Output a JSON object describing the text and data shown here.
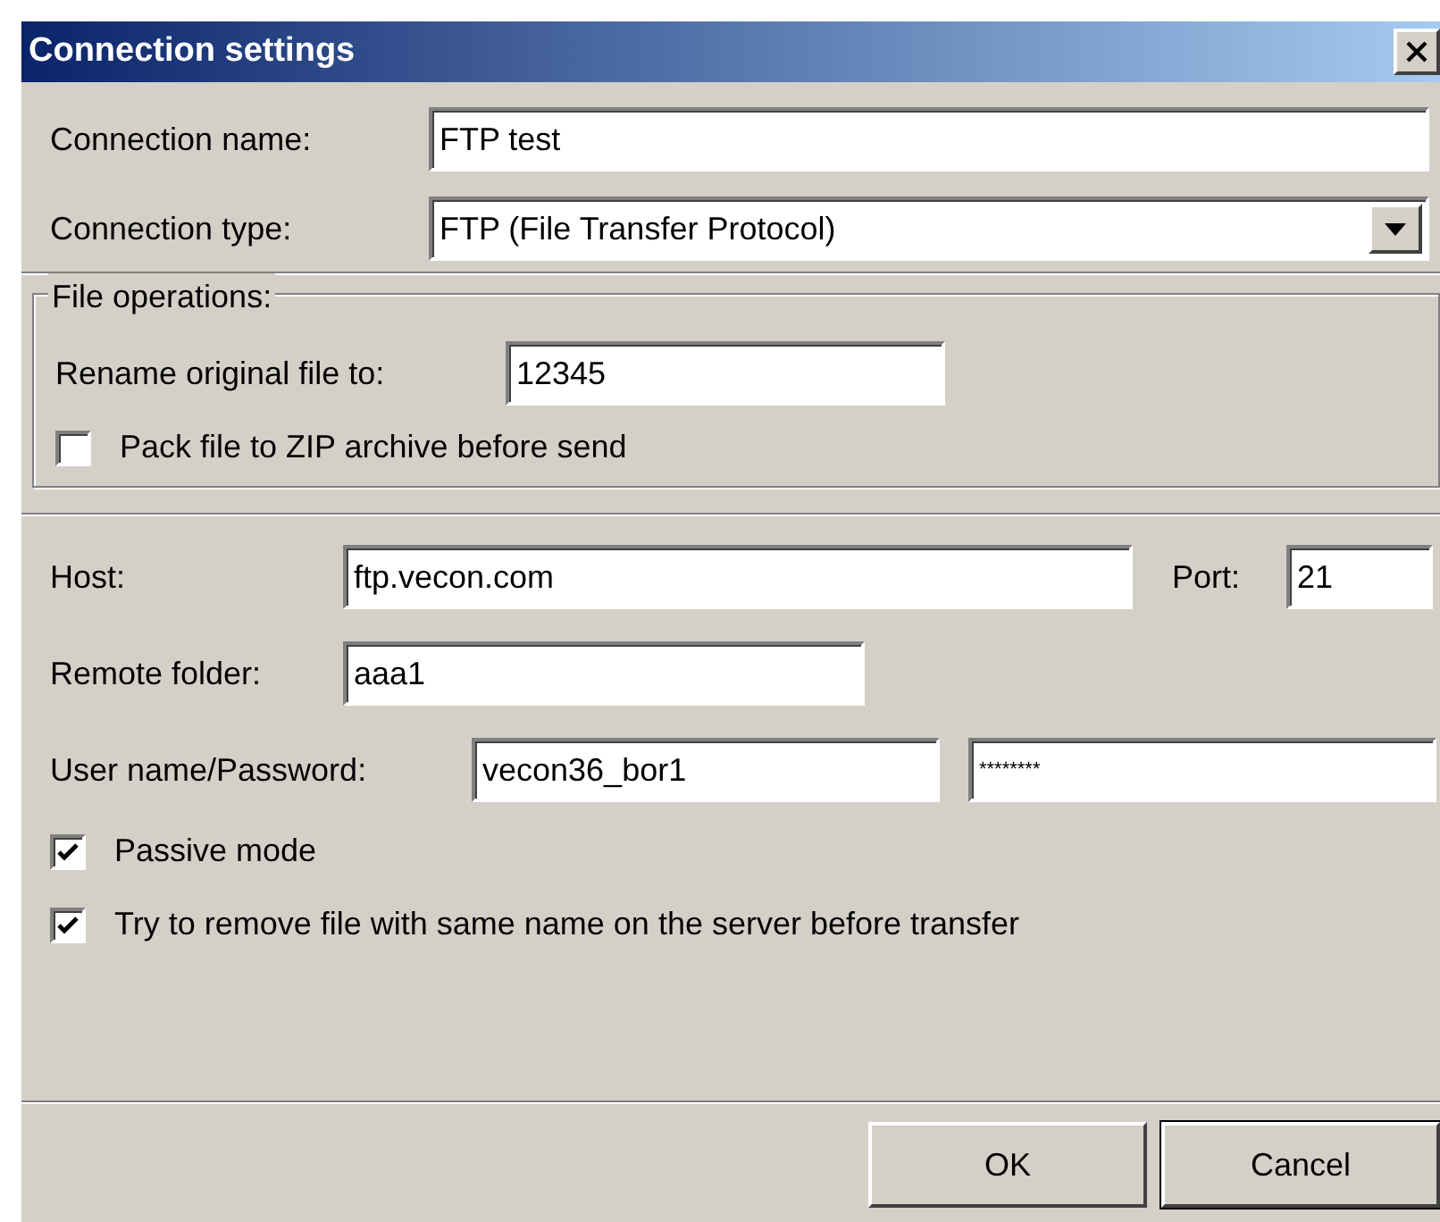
{
  "window": {
    "title": "Connection settings"
  },
  "connection_name": {
    "label": "Connection name:",
    "value": "FTP test"
  },
  "connection_type": {
    "label": "Connection type:",
    "value": "FTP (File Transfer Protocol)"
  },
  "file_operations": {
    "title": "File operations:",
    "rename": {
      "label": "Rename original file to:",
      "value": "12345"
    },
    "pack_zip": {
      "label": "Pack file to ZIP archive before send",
      "checked": false
    }
  },
  "host": {
    "label": "Host:",
    "value": "ftp.vecon.com"
  },
  "port": {
    "label": "Port:",
    "value": "21"
  },
  "remote_folder": {
    "label": "Remote folder:",
    "value": "aaa1"
  },
  "credentials": {
    "label": "User name/Password:",
    "user": "vecon36_bor1",
    "password": "********"
  },
  "options": [
    {
      "label": "Passive mode",
      "checked": true
    },
    {
      "label": "Try to remove file with same name on the server before transfer",
      "checked": true
    }
  ],
  "buttons": [
    {
      "label": "OK",
      "default": false
    },
    {
      "label": "Cancel",
      "default": true
    }
  ]
}
